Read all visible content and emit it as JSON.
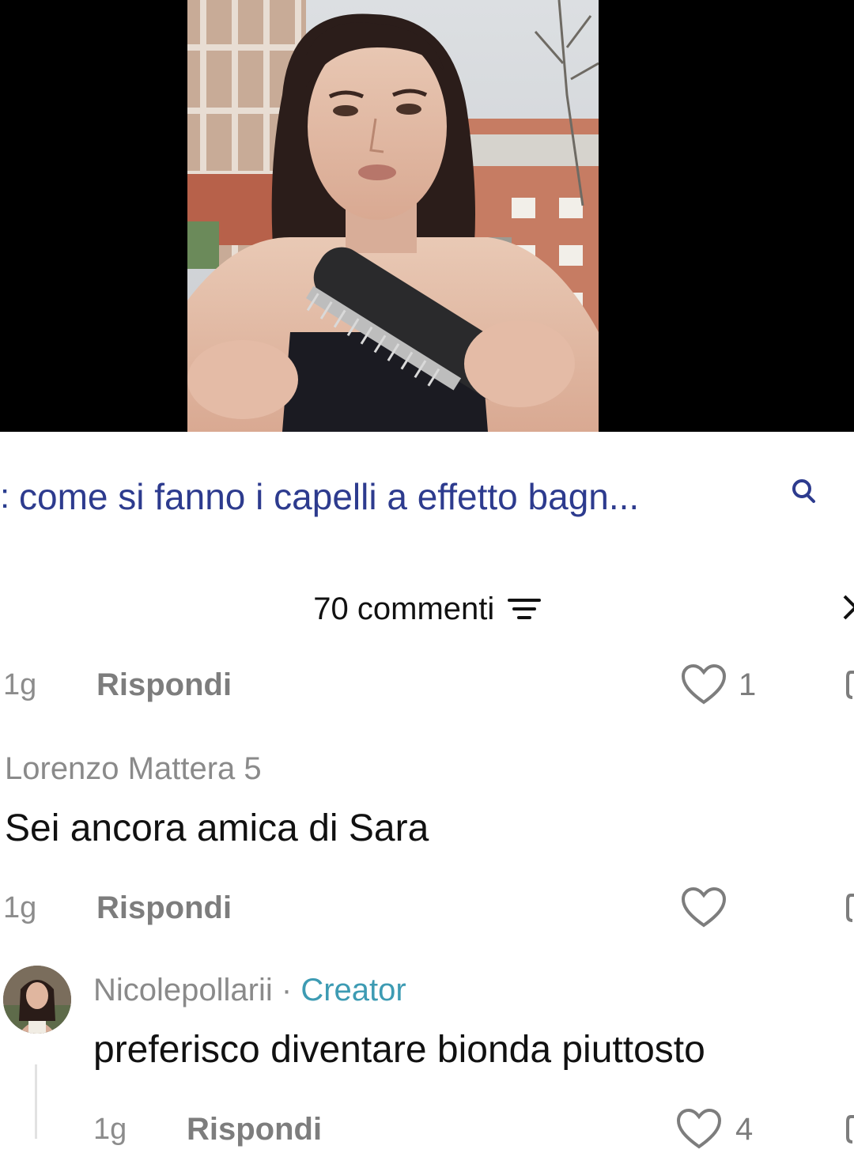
{
  "search": {
    "prefix": ":",
    "query": "come si fanno i capelli a effetto bagn..."
  },
  "comments_header": {
    "title": "70 commenti"
  },
  "comments": [
    {
      "time": "1g",
      "reply_label": "Rispondi",
      "likes": "1"
    },
    {
      "username": "Lorenzo Mattera 5",
      "text": "Sei ancora amica di Sara",
      "time": "1g",
      "reply_label": "Rispondi",
      "likes": ""
    },
    {
      "username": "Nicolepollarii",
      "separator": " · ",
      "badge": "Creator",
      "text": "preferisco diventare bionda piuttosto",
      "time": "1g",
      "reply_label": "Rispondi",
      "likes": "4"
    }
  ],
  "colors": {
    "search_text": "#2d3b8e",
    "creator_badge": "#3d9bb3",
    "muted_text": "#8a8a8a",
    "video_background": "#000000"
  },
  "icons": {
    "search": "search-icon",
    "sort": "sort-icon",
    "close": "close-icon",
    "like": "heart-icon",
    "dislike": "dislike-icon"
  }
}
